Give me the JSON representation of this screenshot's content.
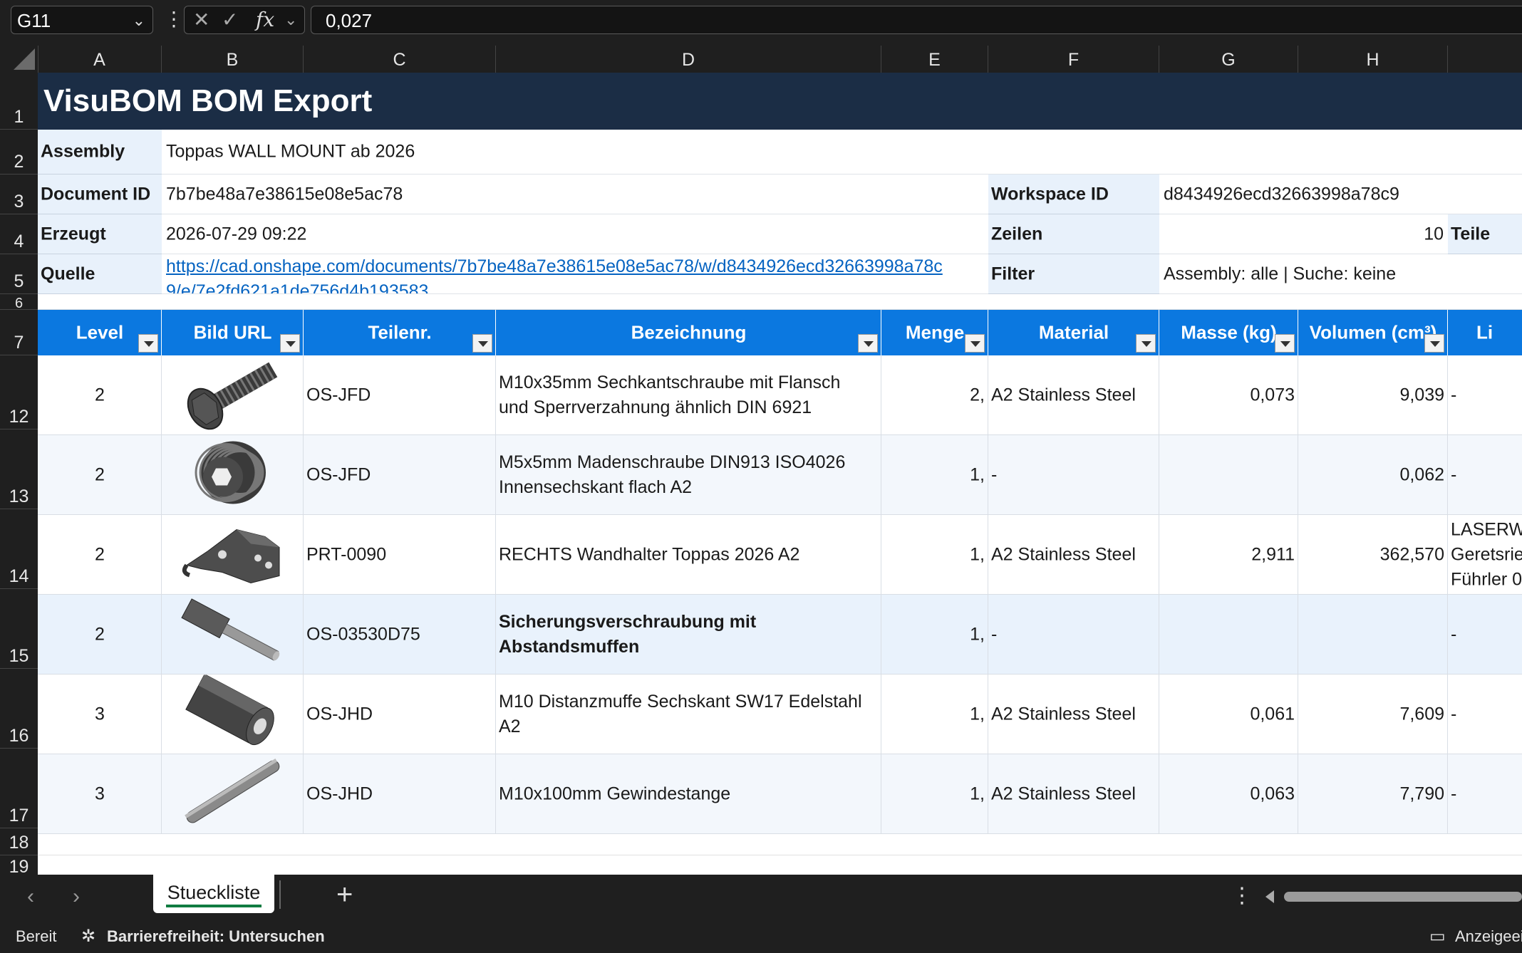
{
  "formula_bar": {
    "name_box": "G11",
    "formula": "0,027",
    "fx_label": "fx"
  },
  "columns": [
    "A",
    "B",
    "C",
    "D",
    "E",
    "F",
    "G",
    "H"
  ],
  "rows_visible": [
    "1",
    "2",
    "3",
    "4",
    "5",
    "6",
    "7",
    "12",
    "13",
    "14",
    "15",
    "16",
    "17",
    "18",
    "19"
  ],
  "header": {
    "title": "VisuBOM BOM Export",
    "assembly_label": "Assembly",
    "assembly_value": "Toppas WALL MOUNT ab 2026",
    "document_label": "Document ID",
    "document_value": "7b7be48a7e38615e08e5ac78",
    "workspace_label": "Workspace ID",
    "workspace_value": "d8434926ecd32663998a78c9",
    "created_label": "Erzeugt",
    "created_value": "2026-07-29 09:22",
    "rows_label": "Zeilen",
    "rows_value": "10",
    "parts_label": "Teile",
    "source_label": "Quelle",
    "source_value_line1": "https://cad.onshape.com/documents/7b7be48a7e38615e08e5ac78/w/d8434926ecd32663998a78c",
    "source_value_line2": "9/e/7e2fd621a1de756d4b193583",
    "filter_label": "Filter",
    "filter_value": "Assembly: alle | Suche: keine"
  },
  "table_headers": {
    "level": "Level",
    "image": "Bild URL",
    "part_no": "Teilenr.",
    "name": "Bezeichnung",
    "qty": "Menge",
    "material": "Material",
    "mass": "Masse (kg)",
    "volume": "Volumen (cm³)",
    "extra": "Li"
  },
  "table_rows": [
    {
      "row": "12",
      "level": "2",
      "icon": "screw-flange-icon",
      "part_no": "OS-JFD",
      "name_l1": "M10x35mm Sechkantschraube mit Flansch",
      "name_l2": "und Sperrverzahnung ähnlich DIN 6921",
      "qty": "2,",
      "material": "A2 Stainless Steel",
      "mass": "0,073",
      "volume": "9,039",
      "extra_l1": "-",
      "extra_l2": "",
      "extra_l3": "",
      "bold": false
    },
    {
      "row": "13",
      "level": "2",
      "icon": "set-screw-icon",
      "part_no": "OS-JFD",
      "name_l1": "M5x5mm Madenschraube DIN913 ISO4026",
      "name_l2": "Innensechskant flach A2",
      "qty": "1,",
      "material": "-",
      "mass": "",
      "volume": "0,062",
      "extra_l1": "-",
      "extra_l2": "",
      "extra_l3": "",
      "bold": false
    },
    {
      "row": "14",
      "level": "2",
      "icon": "bracket-icon",
      "part_no": "PRT-0090",
      "name_l1": "RECHTS Wandhalter Toppas 2026 A2",
      "name_l2": "",
      "qty": "1,",
      "material": "A2 Stainless Steel",
      "mass": "2,911",
      "volume": "362,570",
      "extra_l1": "LASERW",
      "extra_l2": "Geretsrie",
      "extra_l3": "Führler 0",
      "bold": false
    },
    {
      "row": "15",
      "level": "2",
      "icon": "bolt-assembly-icon",
      "part_no": "OS-03530D75",
      "name_l1": "Sicherungsverschraubung mit",
      "name_l2": "Abstandsmuffen",
      "qty": "1,",
      "material": "-",
      "mass": "",
      "volume": "",
      "extra_l1": "-",
      "extra_l2": "",
      "extra_l3": "",
      "bold": true
    },
    {
      "row": "16",
      "level": "3",
      "icon": "hex-spacer-icon",
      "part_no": "OS-JHD",
      "name_l1": "M10 Distanzmuffe Sechskant SW17 Edelstahl",
      "name_l2": "A2",
      "qty": "1,",
      "material": "A2 Stainless Steel",
      "mass": "0,061",
      "volume": "7,609",
      "extra_l1": "-",
      "extra_l2": "",
      "extra_l3": "",
      "bold": false
    },
    {
      "row": "17",
      "level": "3",
      "icon": "threaded-rod-icon",
      "part_no": "OS-JHD",
      "name_l1": "M10x100mm Gewindestange",
      "name_l2": "",
      "qty": "1,",
      "material": "A2 Stainless Steel",
      "mass": "0,063",
      "volume": "7,790",
      "extra_l1": "-",
      "extra_l2": "",
      "extra_l3": "",
      "bold": false
    }
  ],
  "sheet_tabs": [
    "Stueckliste"
  ],
  "status_bar": {
    "ready": "Bereit",
    "accessibility": "Barrierefreiheit: Untersuchen",
    "display": "Anzeigeei"
  },
  "colors": {
    "title_bg": "#1b2d45",
    "header_blue": "#0b78e0",
    "label_bg": "#e8f1fb",
    "link": "#0563c1",
    "sheet_tab_underline": "#107c41"
  }
}
